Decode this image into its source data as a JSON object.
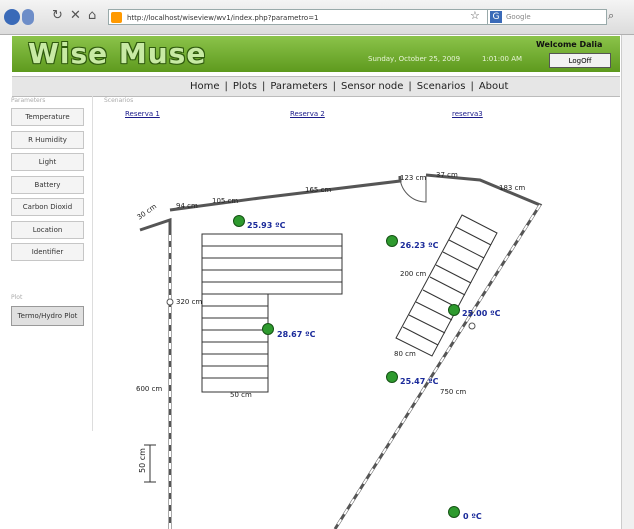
{
  "browser": {
    "url": "http://localhost/wiseview/wv1/index.php?parametro=1",
    "search_placeholder": "Google"
  },
  "header": {
    "logo": "Wise Muse",
    "date": "Sunday, October 25, 2009",
    "time": "1:01:00 AM",
    "welcome": "Welcome Dalia",
    "logoff_label": "LogOff"
  },
  "nav": {
    "items": [
      "Home",
      "Plots",
      "Parameters",
      "Sensor node",
      "Scenarios",
      "About"
    ]
  },
  "sidebar": {
    "section_label": "Parameters",
    "items": [
      "Temperature",
      "R Humidity",
      "Light",
      "Battery",
      "Carbon Dioxid",
      "Location",
      "Identifier"
    ],
    "plot_label": "Plot",
    "plot_button": "Termo/Hydro Plot"
  },
  "scenarios": {
    "label": "Scenarios",
    "items": [
      "Reserva 1",
      "Reserva 2",
      "reserva3"
    ]
  },
  "map": {
    "dimensions": {
      "d30": "30 cm",
      "d94": "94 cm",
      "d105": "105 cm",
      "d165": "165 cm",
      "d123": "123 cm",
      "d37": "37 cm",
      "d183": "183 cm",
      "d320": "320 cm",
      "d600": "600 cm",
      "d50": "50 cm",
      "d200": "200 cm",
      "d80": "80 cm",
      "d750": "750 cm",
      "scale": "50 cm"
    },
    "sensors": [
      {
        "label": "25.93 ºC"
      },
      {
        "label": "26.23 ºC"
      },
      {
        "label": "25.00 ºC"
      },
      {
        "label": "28.67 ºC"
      },
      {
        "label": "25.47 ºC"
      },
      {
        "label": "0 ºC"
      }
    ],
    "colors": {
      "wall": "#555555",
      "sensor": "#2e9a2e",
      "temp_text": "#1a2a9a"
    }
  }
}
